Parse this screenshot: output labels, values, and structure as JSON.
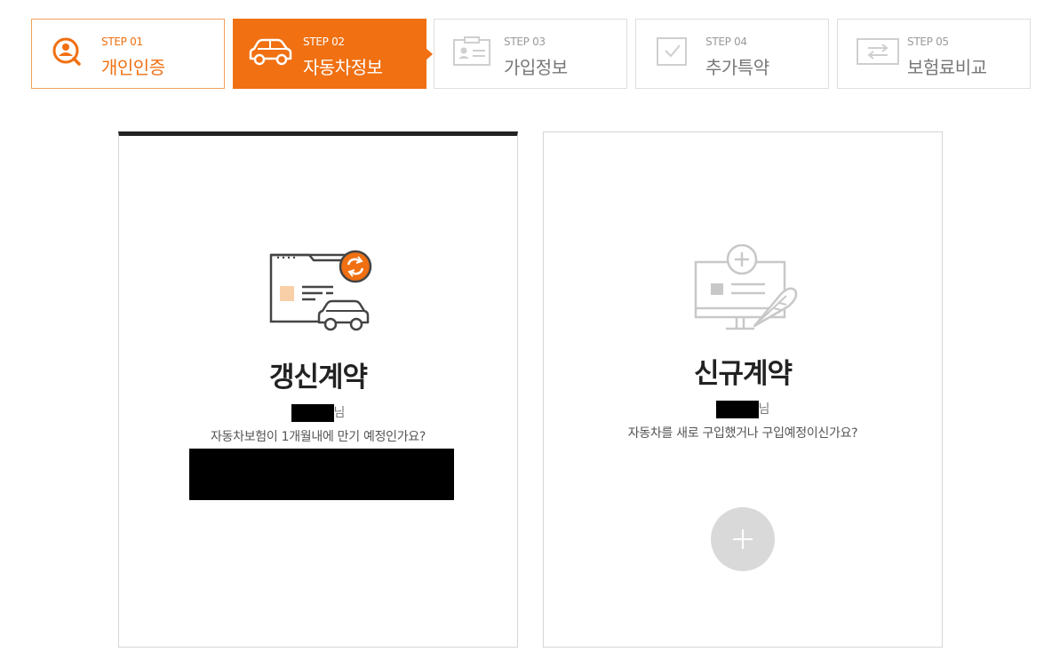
{
  "steps": [
    {
      "num": "STEP 01",
      "title": "개인인증",
      "icon": "person-search-icon",
      "state": "done"
    },
    {
      "num": "STEP 02",
      "title": "자동차정보",
      "icon": "car-icon",
      "state": "active"
    },
    {
      "num": "STEP 03",
      "title": "가입정보",
      "icon": "id-card-icon",
      "state": "pending"
    },
    {
      "num": "STEP 04",
      "title": "추가특약",
      "icon": "checkbox-icon",
      "state": "pending"
    },
    {
      "num": "STEP 05",
      "title": "보험료비교",
      "icon": "compare-arrows-icon",
      "state": "pending"
    }
  ],
  "colors": {
    "accent": "#f07012",
    "accent_border": "#f2a15a",
    "inactive_text": "#777777",
    "dark": "#222222",
    "card_border": "#d6d6d6",
    "add_button": "#d9d9d9"
  },
  "renewal": {
    "title": "갱신계약",
    "name_suffix": "님",
    "description": "자동차보험이 1개월내에 만기 예정인가요?",
    "icon": "renewal-document-car-icon"
  },
  "new_contract": {
    "title": "신규계약",
    "name_suffix": "님",
    "description": "자동차를 새로 구입했거나 구입예정이신가요?",
    "icon": "new-contract-monitor-pen-icon",
    "add_icon": "plus-icon"
  }
}
